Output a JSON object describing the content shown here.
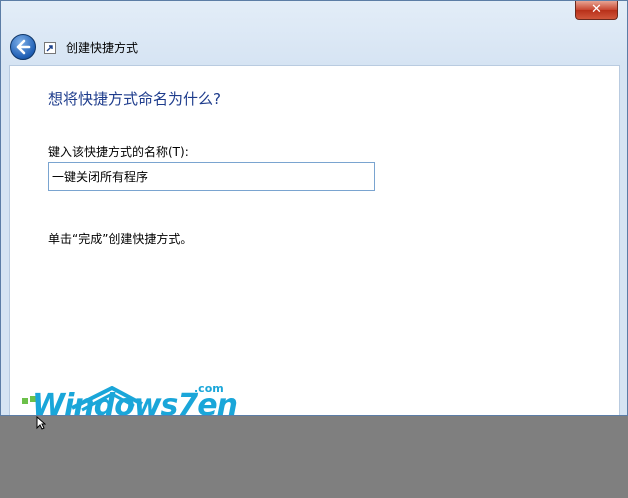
{
  "titlebar": {
    "close_glyph": "✕"
  },
  "header": {
    "title": "创建快捷方式",
    "back_icon": "back-arrow-icon",
    "wizard_icon": "shortcut-icon"
  },
  "main": {
    "heading": "想将快捷方式命名为什么?",
    "name_label": "键入该快捷方式的名称(T):",
    "name_value": "一键关闭所有程序",
    "hint": "单击“完成”创建快捷方式。"
  },
  "watermark": {
    "text": "Windows7en",
    "suffix": ".com"
  },
  "colors": {
    "heading": "#1e3c8c",
    "accent": "#1aa6d9",
    "close": "#c7452f"
  }
}
